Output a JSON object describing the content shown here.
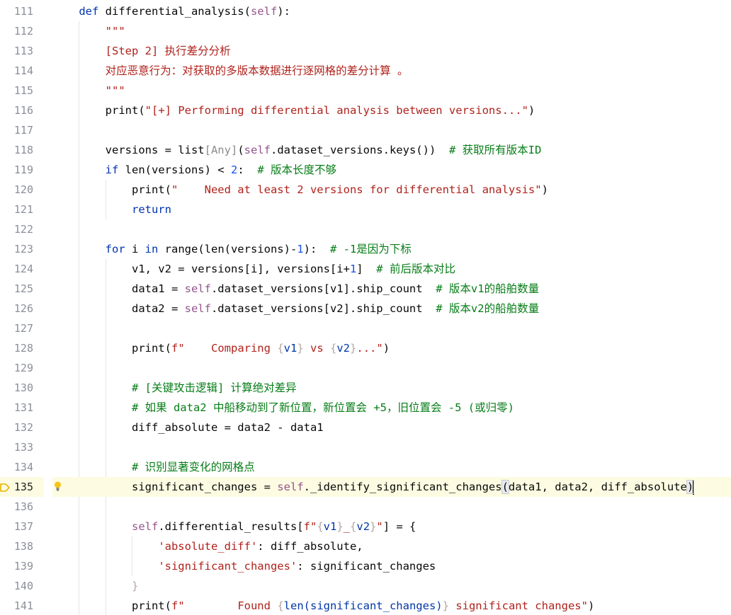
{
  "editor": {
    "current_line": 135,
    "lines": [
      {
        "num": "111"
      },
      {
        "num": "112"
      },
      {
        "num": "113"
      },
      {
        "num": "114"
      },
      {
        "num": "115"
      },
      {
        "num": "116"
      },
      {
        "num": "117"
      },
      {
        "num": "118"
      },
      {
        "num": "119"
      },
      {
        "num": "120"
      },
      {
        "num": "121"
      },
      {
        "num": "122"
      },
      {
        "num": "123"
      },
      {
        "num": "124"
      },
      {
        "num": "125"
      },
      {
        "num": "126"
      },
      {
        "num": "127"
      },
      {
        "num": "128"
      },
      {
        "num": "129"
      },
      {
        "num": "130"
      },
      {
        "num": "131"
      },
      {
        "num": "132"
      },
      {
        "num": "133"
      },
      {
        "num": "134"
      },
      {
        "num": "135"
      },
      {
        "num": "136"
      },
      {
        "num": "137"
      },
      {
        "num": "138"
      },
      {
        "num": "139"
      },
      {
        "num": "140"
      },
      {
        "num": "141"
      }
    ],
    "code": [
      [
        [
          "    ",
          ""
        ],
        [
          "def",
          "kw"
        ],
        [
          " differential_analysis(",
          ""
        ],
        [
          "self",
          "slf"
        ],
        [
          "):",
          ""
        ]
      ],
      [
        [
          "        ",
          ""
        ],
        [
          "\"\"\"",
          "doc"
        ]
      ],
      [
        [
          "        ",
          ""
        ],
        [
          "[Step 2] 执行差分分析",
          "doc"
        ]
      ],
      [
        [
          "        ",
          ""
        ],
        [
          "对应恶意行为：对获取的多版本数据进行逐网格的差分计算 。",
          "doc"
        ]
      ],
      [
        [
          "        ",
          ""
        ],
        [
          "\"\"\"",
          "doc"
        ]
      ],
      [
        [
          "        print(",
          ""
        ],
        [
          "\"[+] Performing differential analysis between versions...\"",
          "str"
        ],
        [
          ")",
          ""
        ]
      ],
      [],
      [
        [
          "        versions = list",
          ""
        ],
        [
          "[Any]",
          "typ"
        ],
        [
          "(",
          ""
        ],
        [
          "self",
          "slf"
        ],
        [
          ".dataset_versions.keys())  ",
          ""
        ],
        [
          "# 获取所有版本ID",
          "cmt"
        ]
      ],
      [
        [
          "        ",
          ""
        ],
        [
          "if",
          "kw"
        ],
        [
          " len(versions) < ",
          ""
        ],
        [
          "2",
          "num"
        ],
        [
          ":  ",
          ""
        ],
        [
          "# 版本长度不够",
          "cmt"
        ]
      ],
      [
        [
          "            print(",
          ""
        ],
        [
          "\"    Need at least 2 versions for differential analysis\"",
          "str"
        ],
        [
          ")",
          ""
        ]
      ],
      [
        [
          "            ",
          ""
        ],
        [
          "return",
          "kw"
        ]
      ],
      [],
      [
        [
          "        ",
          ""
        ],
        [
          "for",
          "kw"
        ],
        [
          " i ",
          ""
        ],
        [
          "in",
          "kw"
        ],
        [
          " range(len(versions)-",
          ""
        ],
        [
          "1",
          "num"
        ],
        [
          "):  ",
          ""
        ],
        [
          "# -1是因为下标",
          "cmt"
        ]
      ],
      [
        [
          "            v1, v2 = versions[i], versions[i+",
          ""
        ],
        [
          "1",
          "num"
        ],
        [
          "]  ",
          ""
        ],
        [
          "# 前后版本对比",
          "cmt"
        ]
      ],
      [
        [
          "            data1 = ",
          ""
        ],
        [
          "self",
          "slf"
        ],
        [
          ".dataset_versions[v1].ship_count  ",
          ""
        ],
        [
          "# 版本v1的船舶数量",
          "cmt"
        ]
      ],
      [
        [
          "            data2 = ",
          ""
        ],
        [
          "self",
          "slf"
        ],
        [
          ".dataset_versions[v2].ship_count  ",
          ""
        ],
        [
          "# 版本v2的船舶数量",
          "cmt"
        ]
      ],
      [],
      [
        [
          "            print(",
          ""
        ],
        [
          "f",
          "str"
        ],
        [
          "\"    Comparing ",
          "str"
        ],
        [
          "{",
          "brace"
        ],
        [
          "v1",
          "fmt"
        ],
        [
          "}",
          "brace"
        ],
        [
          " vs ",
          "str"
        ],
        [
          "{",
          "brace"
        ],
        [
          "v2",
          "fmt"
        ],
        [
          "}",
          "brace"
        ],
        [
          "...\"",
          "str"
        ],
        [
          ")",
          ""
        ]
      ],
      [],
      [
        [
          "            ",
          ""
        ],
        [
          "# [关键攻击逻辑] 计算绝对差异",
          "cmt"
        ]
      ],
      [
        [
          "            ",
          ""
        ],
        [
          "# 如果 data2 中船移动到了新位置，新位置会 +5，旧位置会 -5 (或归零)",
          "cmt"
        ]
      ],
      [
        [
          "            diff_absolute = data2 - data1",
          ""
        ]
      ],
      [],
      [
        [
          "            ",
          ""
        ],
        [
          "# 识别显著变化的网格点",
          "cmt"
        ]
      ],
      [
        [
          "            significant_changes = ",
          ""
        ],
        [
          "self",
          "slf"
        ],
        [
          "._identify_significant_changes",
          ""
        ],
        [
          "(",
          "match"
        ],
        [
          "data1, data2, diff_absolute",
          ""
        ],
        [
          ")",
          "match"
        ],
        [
          "",
          "caret"
        ]
      ],
      [],
      [
        [
          "            ",
          ""
        ],
        [
          "self",
          "slf"
        ],
        [
          ".differential_results[",
          ""
        ],
        [
          "f",
          "str"
        ],
        [
          "\"",
          "str"
        ],
        [
          "{",
          "brace"
        ],
        [
          "v1",
          "fmt"
        ],
        [
          "}",
          "brace"
        ],
        [
          "_",
          "str"
        ],
        [
          "{",
          "brace"
        ],
        [
          "v2",
          "fmt"
        ],
        [
          "}",
          "brace"
        ],
        [
          "\"",
          "str"
        ],
        [
          "] = {",
          ""
        ]
      ],
      [
        [
          "                ",
          ""
        ],
        [
          "'absolute_diff'",
          "str"
        ],
        [
          ": diff_absolute,",
          ""
        ]
      ],
      [
        [
          "                ",
          ""
        ],
        [
          "'significant_changes'",
          "str"
        ],
        [
          ": significant_changes",
          ""
        ]
      ],
      [
        [
          "            ",
          ""
        ],
        [
          "}",
          "brace"
        ]
      ],
      [
        [
          "            print(",
          ""
        ],
        [
          "f",
          "str"
        ],
        [
          "\"        Found ",
          "str"
        ],
        [
          "{",
          "brace"
        ],
        [
          "len(significant_changes)",
          "fmt"
        ],
        [
          "}",
          "brace"
        ],
        [
          " significant changes\"",
          "str"
        ],
        [
          ")",
          ""
        ]
      ]
    ]
  },
  "colors": {
    "background": "#ffffff",
    "current_line": "#fdfce2",
    "keyword": "#0033b3",
    "string": "#b0221c",
    "comment": "#067d17",
    "number": "#1750eb",
    "self": "#94558d",
    "line_number": "#8b8f99"
  },
  "icons": {
    "gutter_marker": "breakpoint-arrow-icon",
    "intention": "bulb-icon"
  }
}
